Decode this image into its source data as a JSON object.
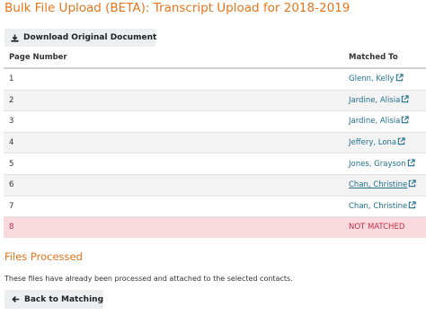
{
  "page": {
    "title": "Bulk File Upload (BETA): Transcript Upload for 2018-2019"
  },
  "toolbar": {
    "download_label": "Download Original Document"
  },
  "table": {
    "headers": {
      "page_number": "Page Number",
      "matched_to": "Matched To"
    },
    "rows": [
      {
        "page": "1",
        "matched": "Glenn, Kelly",
        "link": true
      },
      {
        "page": "2",
        "matched": "Jardine, Alisia",
        "link": true
      },
      {
        "page": "3",
        "matched": "Jardine, Alisia",
        "link": true
      },
      {
        "page": "4",
        "matched": "Jeffery, Lona",
        "link": true
      },
      {
        "page": "5",
        "matched": "Jones, Grayson",
        "link": true
      },
      {
        "page": "6",
        "matched": "Chan, Christine",
        "link": true
      },
      {
        "page": "7",
        "matched": "Chan, Christine",
        "link": true
      },
      {
        "page": "8",
        "matched": "NOT MATCHED",
        "link": false
      }
    ]
  },
  "files_processed": {
    "title": "Files Processed",
    "message": "These files have already been processed and attached to the selected contacts."
  },
  "footer": {
    "back_label": "Back to Matching"
  },
  "icons": {
    "download": "download-icon",
    "external": "external-link-icon",
    "back": "arrow-left-icon"
  },
  "colors": {
    "accent": "#e8741c",
    "link": "#1f6f8b",
    "unmatched_bg": "#f8d9de",
    "unmatched_text": "#c2304a"
  }
}
